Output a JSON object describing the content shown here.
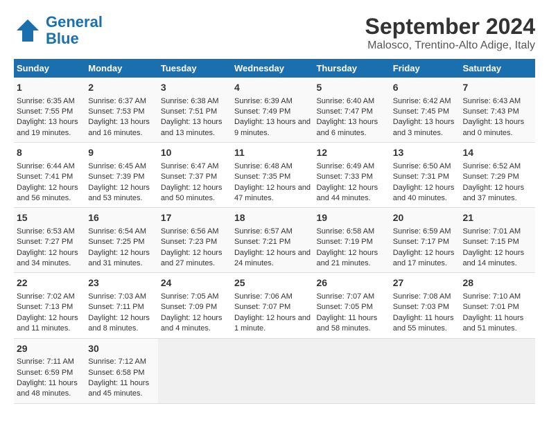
{
  "logo": {
    "line1": "General",
    "line2": "Blue"
  },
  "title": "September 2024",
  "subtitle": "Malosco, Trentino-Alto Adige, Italy",
  "headers": [
    "Sunday",
    "Monday",
    "Tuesday",
    "Wednesday",
    "Thursday",
    "Friday",
    "Saturday"
  ],
  "weeks": [
    [
      {
        "day": "1",
        "rise": "6:35 AM",
        "set": "7:55 PM",
        "daylight": "13 hours and 19 minutes."
      },
      {
        "day": "2",
        "rise": "6:37 AM",
        "set": "7:53 PM",
        "daylight": "13 hours and 16 minutes."
      },
      {
        "day": "3",
        "rise": "6:38 AM",
        "set": "7:51 PM",
        "daylight": "13 hours and 13 minutes."
      },
      {
        "day": "4",
        "rise": "6:39 AM",
        "set": "7:49 PM",
        "daylight": "13 hours and 9 minutes."
      },
      {
        "day": "5",
        "rise": "6:40 AM",
        "set": "7:47 PM",
        "daylight": "13 hours and 6 minutes."
      },
      {
        "day": "6",
        "rise": "6:42 AM",
        "set": "7:45 PM",
        "daylight": "13 hours and 3 minutes."
      },
      {
        "day": "7",
        "rise": "6:43 AM",
        "set": "7:43 PM",
        "daylight": "13 hours and 0 minutes."
      }
    ],
    [
      {
        "day": "8",
        "rise": "6:44 AM",
        "set": "7:41 PM",
        "daylight": "12 hours and 56 minutes."
      },
      {
        "day": "9",
        "rise": "6:45 AM",
        "set": "7:39 PM",
        "daylight": "12 hours and 53 minutes."
      },
      {
        "day": "10",
        "rise": "6:47 AM",
        "set": "7:37 PM",
        "daylight": "12 hours and 50 minutes."
      },
      {
        "day": "11",
        "rise": "6:48 AM",
        "set": "7:35 PM",
        "daylight": "12 hours and 47 minutes."
      },
      {
        "day": "12",
        "rise": "6:49 AM",
        "set": "7:33 PM",
        "daylight": "12 hours and 44 minutes."
      },
      {
        "day": "13",
        "rise": "6:50 AM",
        "set": "7:31 PM",
        "daylight": "12 hours and 40 minutes."
      },
      {
        "day": "14",
        "rise": "6:52 AM",
        "set": "7:29 PM",
        "daylight": "12 hours and 37 minutes."
      }
    ],
    [
      {
        "day": "15",
        "rise": "6:53 AM",
        "set": "7:27 PM",
        "daylight": "12 hours and 34 minutes."
      },
      {
        "day": "16",
        "rise": "6:54 AM",
        "set": "7:25 PM",
        "daylight": "12 hours and 31 minutes."
      },
      {
        "day": "17",
        "rise": "6:56 AM",
        "set": "7:23 PM",
        "daylight": "12 hours and 27 minutes."
      },
      {
        "day": "18",
        "rise": "6:57 AM",
        "set": "7:21 PM",
        "daylight": "12 hours and 24 minutes."
      },
      {
        "day": "19",
        "rise": "6:58 AM",
        "set": "7:19 PM",
        "daylight": "12 hours and 21 minutes."
      },
      {
        "day": "20",
        "rise": "6:59 AM",
        "set": "7:17 PM",
        "daylight": "12 hours and 17 minutes."
      },
      {
        "day": "21",
        "rise": "7:01 AM",
        "set": "7:15 PM",
        "daylight": "12 hours and 14 minutes."
      }
    ],
    [
      {
        "day": "22",
        "rise": "7:02 AM",
        "set": "7:13 PM",
        "daylight": "12 hours and 11 minutes."
      },
      {
        "day": "23",
        "rise": "7:03 AM",
        "set": "7:11 PM",
        "daylight": "12 hours and 8 minutes."
      },
      {
        "day": "24",
        "rise": "7:05 AM",
        "set": "7:09 PM",
        "daylight": "12 hours and 4 minutes."
      },
      {
        "day": "25",
        "rise": "7:06 AM",
        "set": "7:07 PM",
        "daylight": "12 hours and 1 minute."
      },
      {
        "day": "26",
        "rise": "7:07 AM",
        "set": "7:05 PM",
        "daylight": "11 hours and 58 minutes."
      },
      {
        "day": "27",
        "rise": "7:08 AM",
        "set": "7:03 PM",
        "daylight": "11 hours and 55 minutes."
      },
      {
        "day": "28",
        "rise": "7:10 AM",
        "set": "7:01 PM",
        "daylight": "11 hours and 51 minutes."
      }
    ],
    [
      {
        "day": "29",
        "rise": "7:11 AM",
        "set": "6:59 PM",
        "daylight": "11 hours and 48 minutes."
      },
      {
        "day": "30",
        "rise": "7:12 AM",
        "set": "6:58 PM",
        "daylight": "11 hours and 45 minutes."
      },
      null,
      null,
      null,
      null,
      null
    ]
  ]
}
